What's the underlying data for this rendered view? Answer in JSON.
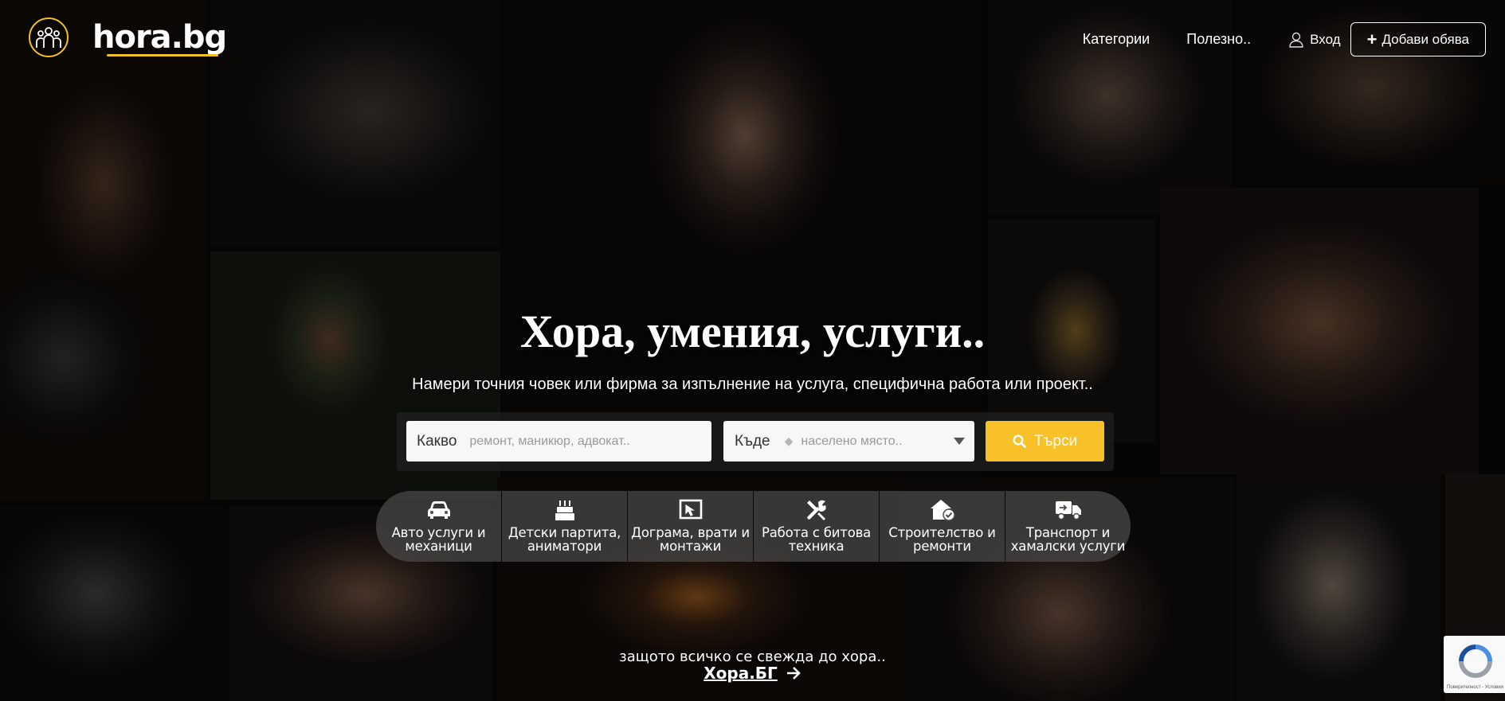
{
  "header": {
    "logo_text": "hora.bg",
    "nav": {
      "categories": "Категории",
      "useful": "Полезно.."
    },
    "login": "Вход",
    "add_listing": "Добави обява"
  },
  "hero": {
    "title": "Хора, умения, услуги..",
    "subtitle": "Намери точния човек или фирма за изпълнение на услуга, специфична работа или проект.."
  },
  "search": {
    "what_label": "Какво",
    "what_placeholder": "ремонт, маникюр, адвокат..",
    "where_label": "Къде",
    "where_placeholder": "населено място..",
    "button": "Търси"
  },
  "categories": [
    {
      "line1": "Авто услуги и",
      "line2": "механици",
      "icon": "car-icon"
    },
    {
      "line1": "Детски партита,",
      "line2": "аниматори",
      "icon": "birthday-cake-icon"
    },
    {
      "line1": "Дограма, врати и",
      "line2": "монтажи",
      "icon": "window-frame-icon"
    },
    {
      "line1": "Работа с битова",
      "line2": "техника",
      "icon": "tools-icon"
    },
    {
      "line1": "Строителство и",
      "line2": "ремонти",
      "icon": "house-check-icon"
    },
    {
      "line1": "Транспорт и",
      "line2": "хамалски услуги",
      "icon": "truck-icon"
    }
  ],
  "footer": {
    "tagline": "защото всичко се свежда до хора..",
    "brand_link": "Хора.БГ"
  },
  "recaptcha": {
    "text": "Поверителност - Условия"
  },
  "colors": {
    "accent": "#f8c12a",
    "logo_ring": "#f3c023"
  }
}
